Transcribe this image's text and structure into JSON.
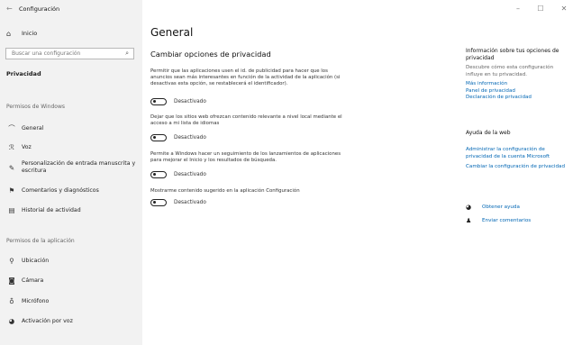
{
  "window": {
    "back_glyph": "←",
    "title": "Configuración",
    "minimize": "–",
    "maximize": "☐",
    "close": "✕"
  },
  "sidebar": {
    "home": {
      "icon": "home-icon",
      "glyph": "⌂",
      "label": "Inicio"
    },
    "search": {
      "placeholder": "Buscar una configuración",
      "icon_glyph": "⌕"
    },
    "current_section": "Privacidad",
    "windows_permissions_header": "Permisos de Windows",
    "windows_items": [
      {
        "icon": "lock-icon",
        "glyph": "⌒",
        "label": "General"
      },
      {
        "icon": "speech-icon",
        "glyph": "ℛ",
        "label": "Voz"
      },
      {
        "icon": "pen-icon",
        "glyph": "✎",
        "label": "Personalización de entrada manuscrita y escritura"
      },
      {
        "icon": "feedback-icon",
        "glyph": "⚑",
        "label": "Comentarios y diagnósticos"
      },
      {
        "icon": "history-icon",
        "glyph": "▤",
        "label": "Historial de actividad"
      }
    ],
    "app_permissions_header": "Permisos de la aplicación",
    "app_items": [
      {
        "icon": "location-icon",
        "glyph": "⚲",
        "label": "Ubicación"
      },
      {
        "icon": "camera-icon",
        "glyph": "◙",
        "label": "Cámara"
      },
      {
        "icon": "microphone-icon",
        "glyph": "♁",
        "label": "Micrófono"
      },
      {
        "icon": "voice-activation-icon",
        "glyph": "◕",
        "label": "Activación por voz"
      }
    ]
  },
  "main": {
    "title": "General",
    "subtitle": "Cambiar opciones de privacidad",
    "options": [
      {
        "description": "Permitir que las aplicaciones usen el id. de publicidad para hacer que los anuncios sean más interesantes en función de la actividad de la aplicación (si desactivas esta opción, se restablecerá el identificador).",
        "state": "Desactivado"
      },
      {
        "description": "Dejar que los sitios web ofrezcan contenido relevante a nivel local mediante el acceso a mi lista de idiomas",
        "state": "Desactivado"
      },
      {
        "description": "Permite a Windows hacer un seguimiento de los lanzamientos de aplicaciones para mejorar el Inicio y los resultados de búsqueda.",
        "state": "Desactivado"
      },
      {
        "description": "Mostrarme contenido sugerido en la aplicación Configuración",
        "state": "Desactivado"
      }
    ]
  },
  "right_panel": {
    "info_heading": "Información sobre tus opciones de privacidad",
    "info_text": "Descubre cómo esta configuración influye en tu privacidad.",
    "links": [
      "Más información",
      "Panel de privacidad",
      "Declaración de privacidad"
    ],
    "web_help_heading": "Ayuda de la web",
    "web_links": [
      "Administrar la configuración de privacidad de la cuenta Microsoft",
      "Cambiar la configuración de privacidad"
    ],
    "actions": [
      {
        "icon": "help-icon",
        "glyph": "◕",
        "label": "Obtener ayuda"
      },
      {
        "icon": "feedback-person-icon",
        "glyph": "♟",
        "label": "Enviar comentarios"
      }
    ]
  },
  "colors": {
    "link": "#0066b4",
    "sidebar_bg": "#f2f2f2"
  }
}
